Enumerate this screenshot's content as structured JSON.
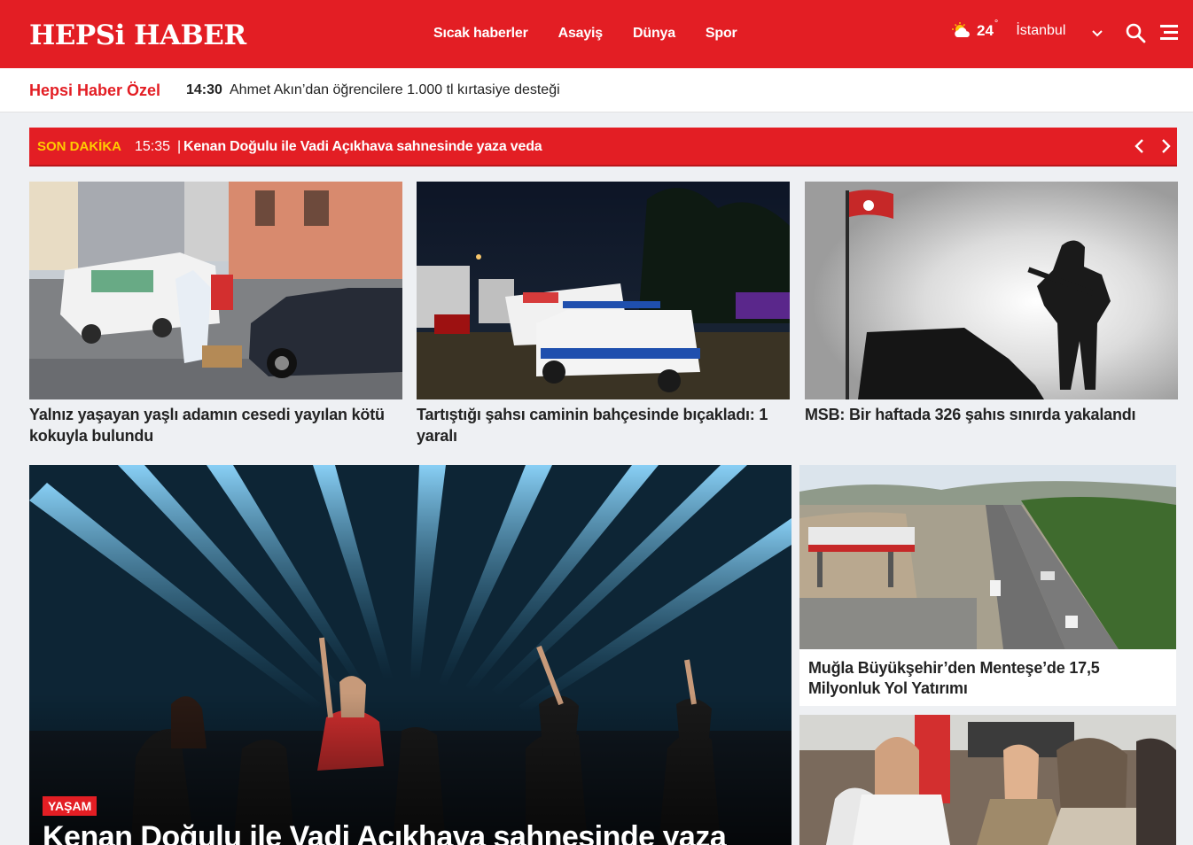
{
  "header": {
    "logo": "HEPSi HABER",
    "nav": [
      "Sıcak haberler",
      "Asayiş",
      "Dünya",
      "Spor"
    ],
    "weather": {
      "temp": "24",
      "deg": "°",
      "city": "İstanbul"
    },
    "brand_color": "#e31e24"
  },
  "special": {
    "label": "Hepsi Haber Özel",
    "time": "14:30",
    "headline": "Ahmet Akın’dan öğrencilere 1.000 tl kırtasiye desteği"
  },
  "breaking": {
    "tag": "SON DAKİKA",
    "time": "15:35",
    "separator": "|",
    "headline": "Kenan Doğulu ile Vadi Açıkhava sahnesinde yaza veda"
  },
  "cards": [
    {
      "title": "Yalnız yaşayan yaşlı adamın cesedi yayılan kötü kokuyla bulundu"
    },
    {
      "title": "Tartıştığı şahsı caminin bahçesinde bıçakladı: 1 yaralı"
    },
    {
      "title": "MSB: Bir haftada 326 şahıs sınırda yakalandı"
    }
  ],
  "hero": {
    "category": "YAŞAM",
    "title": "Kenan Doğulu ile Vadi Açıkhava sahnesinde yaza"
  },
  "side": [
    {
      "title": "Muğla Büyükşehir’den Menteşe’de 17,5 Milyonluk Yol Yatırımı"
    },
    {
      "title": ""
    }
  ],
  "icons": {
    "weather": "partly-cloudy-icon",
    "city_dropdown": "chevron-down-icon",
    "search": "search-icon",
    "menu": "hamburger-menu-icon",
    "prev": "chevron-left-icon",
    "next": "chevron-right-icon"
  }
}
